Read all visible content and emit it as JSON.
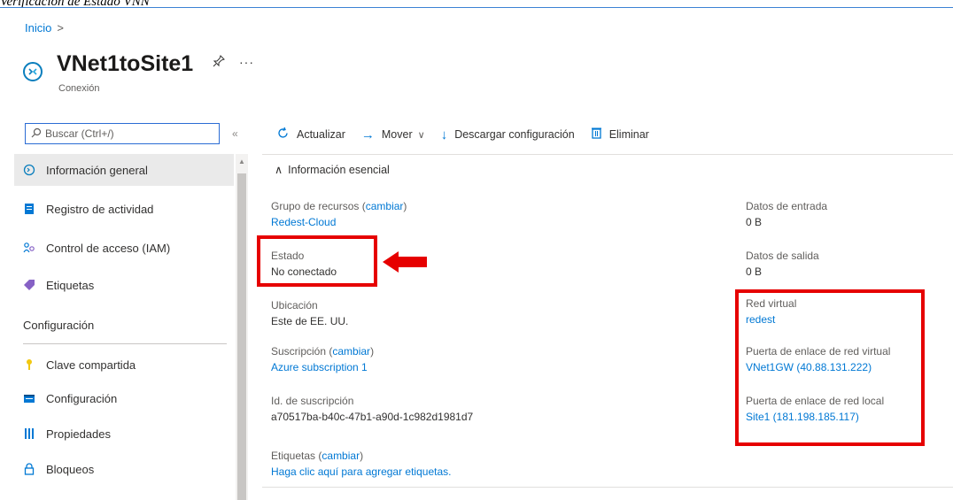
{
  "caption": "Verificación de Estado VNN",
  "breadcrumb": {
    "home": "Inicio",
    "sep": ">"
  },
  "resource": {
    "title": "VNet1toSite1",
    "subtitle": "Conexión",
    "more": "···"
  },
  "search": {
    "value": "Buscar (Ctrl+/)"
  },
  "sidebar": {
    "items": [
      {
        "label": "Información general",
        "icon": "overview-icon"
      },
      {
        "label": "Registro de actividad",
        "icon": "activity-log-icon"
      },
      {
        "label": "Control de acceso (IAM)",
        "icon": "iam-icon"
      },
      {
        "label": "Etiquetas",
        "icon": "tag-icon"
      }
    ],
    "section": "Configuración",
    "config_items": [
      {
        "label": "Clave compartida",
        "icon": "key-icon"
      },
      {
        "label": "Configuración",
        "icon": "config-icon"
      },
      {
        "label": "Propiedades",
        "icon": "properties-icon"
      },
      {
        "label": "Bloqueos",
        "icon": "lock-icon"
      }
    ]
  },
  "toolbar": {
    "refresh": "Actualizar",
    "move": "Mover",
    "download": "Descargar configuración",
    "delete": "Eliminar"
  },
  "essentials": {
    "header": "Información esencial",
    "resource_group_label": "Grupo de recursos",
    "change": "cambiar",
    "resource_group_value": "Redest-Cloud",
    "status_label": "Estado",
    "status_value": "No conectado",
    "location_label": "Ubicación",
    "location_value": "Este de EE. UU.",
    "subscription_label": "Suscripción",
    "subscription_value": "Azure subscription 1",
    "subscription_id_label": "Id. de suscripción",
    "subscription_id_value": "a70517ba-b40c-47b1-a90d-1c982d1981d7",
    "tags_label": "Etiquetas",
    "tags_value": "Haga clic aquí para agregar etiquetas.",
    "data_in_label": "Datos de entrada",
    "data_in_value": "0 B",
    "data_out_label": "Datos de salida",
    "data_out_value": "0 B",
    "vnet_label": "Red virtual",
    "vnet_value": "redest",
    "vgw_label": "Puerta de enlace de red virtual",
    "vgw_value": "VNet1GW (40.88.131.222)",
    "lgw_label": "Puerta de enlace de red local",
    "lgw_value": "Site1 (181.198.185.117)"
  },
  "colors": {
    "accent": "#0078d4",
    "highlight": "#e60000"
  }
}
